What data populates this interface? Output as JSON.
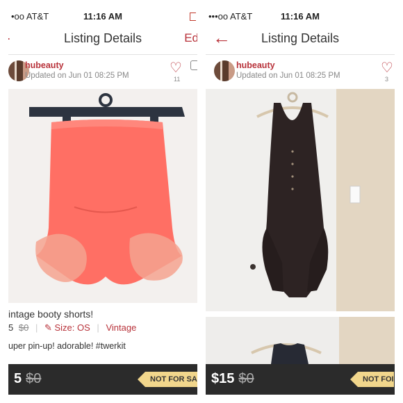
{
  "status": {
    "carrier": "•oo AT&T",
    "time": "11:16 AM"
  },
  "nav": {
    "title": "Listing Details",
    "edit_label": "Ed",
    "back_icon": "←"
  },
  "seller": {
    "name": "hubeauty",
    "updated": "Updated on Jun 01 08:25 PM"
  },
  "left_listing": {
    "likes": "11",
    "title": "intage booty shorts!",
    "price": "5",
    "original_price": "$0",
    "size": "Size: OS",
    "brand": "Vintage",
    "description": "uper pin-up!  adorable!  #twerkit",
    "bottom_price": "5",
    "bottom_original": "$0",
    "badge": "NOT FOR SA"
  },
  "right_listing": {
    "status_carrier": "•••oo AT&T",
    "likes": "3",
    "bottom_price": "$15",
    "bottom_original": "$0",
    "badge": "NOT FOI"
  },
  "colors": {
    "accent": "#b8323a",
    "bar": "#2b2b2b",
    "badge": "#f1d68c"
  }
}
